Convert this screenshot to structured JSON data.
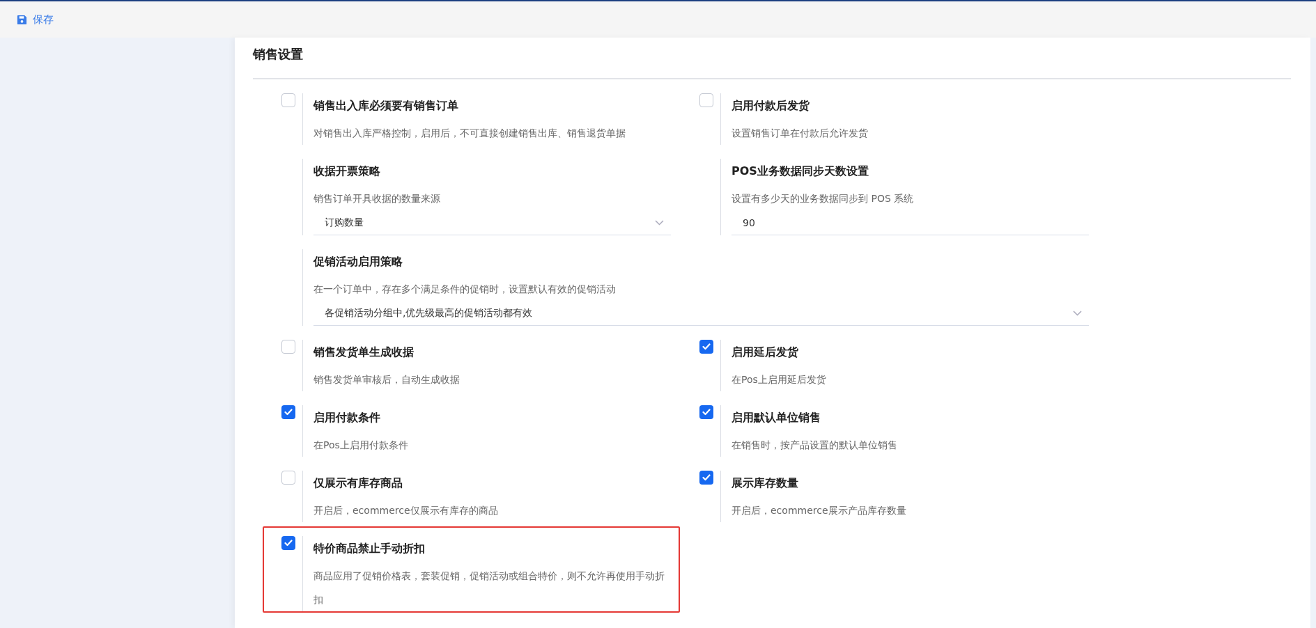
{
  "toolbar": {
    "save_label": "保存"
  },
  "section": {
    "title": "销售设置"
  },
  "items": [
    {
      "kind": "checkbox",
      "title": "销售出入库必须要有销售订单",
      "description": "对销售出入库严格控制，启用后，不可直接创建销售出库、销售退货单据",
      "checked": false,
      "highlighted": false
    },
    {
      "kind": "checkbox",
      "title": "启用付款后发货",
      "description": "设置销售订单在付款后允许发货",
      "checked": false,
      "highlighted": false
    },
    {
      "kind": "select",
      "title": "收据开票策略",
      "description": "销售订单开具收据的数量来源",
      "value": "订购数量",
      "wide": false
    },
    {
      "kind": "input",
      "title": "POS业务数据同步天数设置",
      "description": "设置有多少天的业务数据同步到 POS 系统",
      "value": "90",
      "wide": false
    },
    {
      "kind": "select",
      "title": "促销活动启用策略",
      "description": "在一个订单中，存在多个满足条件的促销时，设置默认有效的促销活动",
      "value": "各促销活动分组中,优先级最高的促销活动都有效",
      "wide": true
    },
    {
      "kind": "checkbox",
      "title": "销售发货单生成收据",
      "description": "销售发货单审核后，自动生成收据",
      "checked": false,
      "highlighted": false
    },
    {
      "kind": "checkbox",
      "title": "启用延后发货",
      "description": "在Pos上启用延后发货",
      "checked": true,
      "highlighted": false
    },
    {
      "kind": "checkbox",
      "title": "启用付款条件",
      "description": "在Pos上启用付款条件",
      "checked": true,
      "highlighted": false
    },
    {
      "kind": "checkbox",
      "title": "启用默认单位销售",
      "description": "在销售时，按产品设置的默认单位销售",
      "checked": true,
      "highlighted": false
    },
    {
      "kind": "checkbox",
      "title": "仅展示有库存商品",
      "description": "开启后，ecommerce仅展示有库存的商品",
      "checked": false,
      "highlighted": false
    },
    {
      "kind": "checkbox",
      "title": "展示库存数量",
      "description": "开启后，ecommerce展示产品库存数量",
      "checked": true,
      "highlighted": false
    },
    {
      "kind": "checkbox",
      "title": "特价商品禁止手动折扣",
      "description": "商品应用了促销价格表，套装促销，促销活动或组合特价，则不允许再使用手动折扣",
      "checked": true,
      "highlighted": true
    }
  ]
}
